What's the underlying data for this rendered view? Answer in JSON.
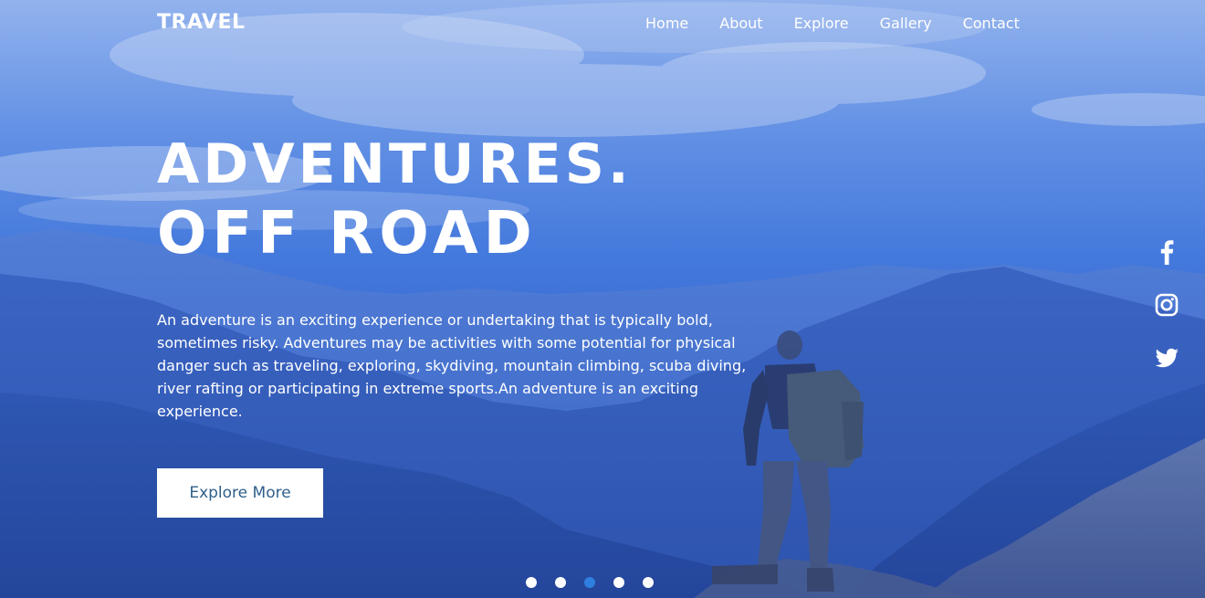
{
  "brand": {
    "name": "TRAVEL"
  },
  "nav": {
    "items": [
      {
        "label": "Home"
      },
      {
        "label": "About"
      },
      {
        "label": "Explore"
      },
      {
        "label": "Gallery"
      },
      {
        "label": "Contact"
      }
    ]
  },
  "hero": {
    "headline_line1": "ADVENTURES.",
    "headline_line2": "OFF ROAD",
    "description": "An adventure is an exciting experience or undertaking that is typically bold, sometimes risky. Adventures may be activities with some potential for physical danger such as traveling, exploring, skydiving, mountain climbing, scuba diving, river rafting or participating in extreme sports.An adventure is an exciting experience.",
    "cta_label": "Explore More"
  },
  "social": {
    "icons": [
      "facebook-icon",
      "instagram-icon",
      "twitter-icon"
    ]
  },
  "slider": {
    "count": 5,
    "active_index": 2,
    "active_color": "#2f7fe0",
    "inactive_color": "#ffffff"
  },
  "colors": {
    "accent": "#2f7fe0",
    "cta_text": "#2f5f8a",
    "overlay": "#3a6bd0"
  }
}
